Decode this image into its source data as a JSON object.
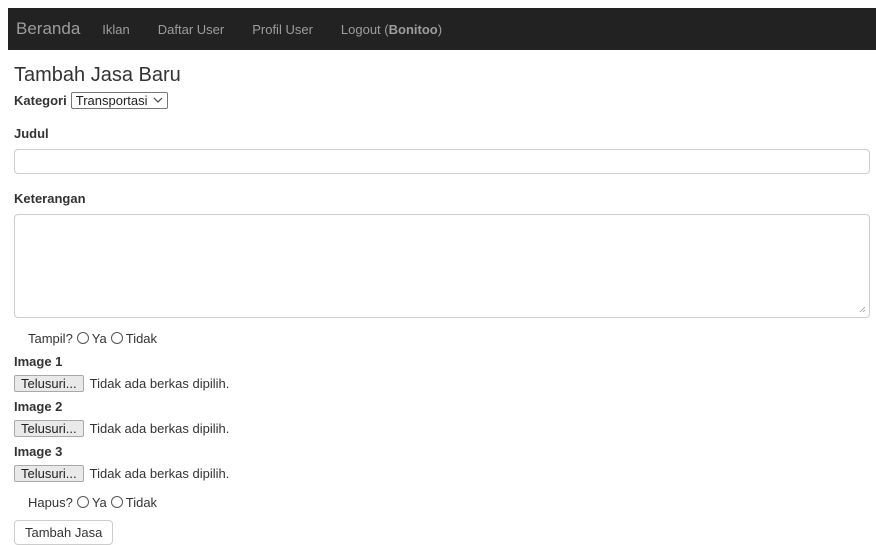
{
  "navbar": {
    "brand": "Beranda",
    "items": [
      "Iklan",
      "Daftar User",
      "Profil User"
    ],
    "logout_prefix": "Logout (",
    "logout_user": "Bonitoo",
    "logout_suffix": ")"
  },
  "page": {
    "title": "Tambah Jasa Baru"
  },
  "form": {
    "kategori_label": "Kategori",
    "kategori_value": "Transportasi",
    "judul_label": "Judul",
    "judul_value": "",
    "keterangan_label": "Keterangan",
    "keterangan_value": "",
    "tampil": {
      "label": "Tampil?",
      "yes": "Ya",
      "no": "Tidak",
      "selected": null
    },
    "images": [
      {
        "label": "Image 1",
        "button": "Telusuri...",
        "status": "Tidak ada berkas dipilih."
      },
      {
        "label": "Image 2",
        "button": "Telusuri...",
        "status": "Tidak ada berkas dipilih."
      },
      {
        "label": "Image 3",
        "button": "Telusuri...",
        "status": "Tidak ada berkas dipilih."
      }
    ],
    "hapus": {
      "label": "Hapus?",
      "yes": "Ya",
      "no": "Tidak",
      "selected": null
    },
    "submit_label": "Tambah Jasa"
  },
  "icons": {
    "select_chevron": "chevron-down-icon",
    "resize_grip": "resize-grip-icon"
  },
  "colors": {
    "navbar_bg": "#222222",
    "navbar_text": "#9d9d9d",
    "border": "#cccccc",
    "text": "#333333"
  }
}
